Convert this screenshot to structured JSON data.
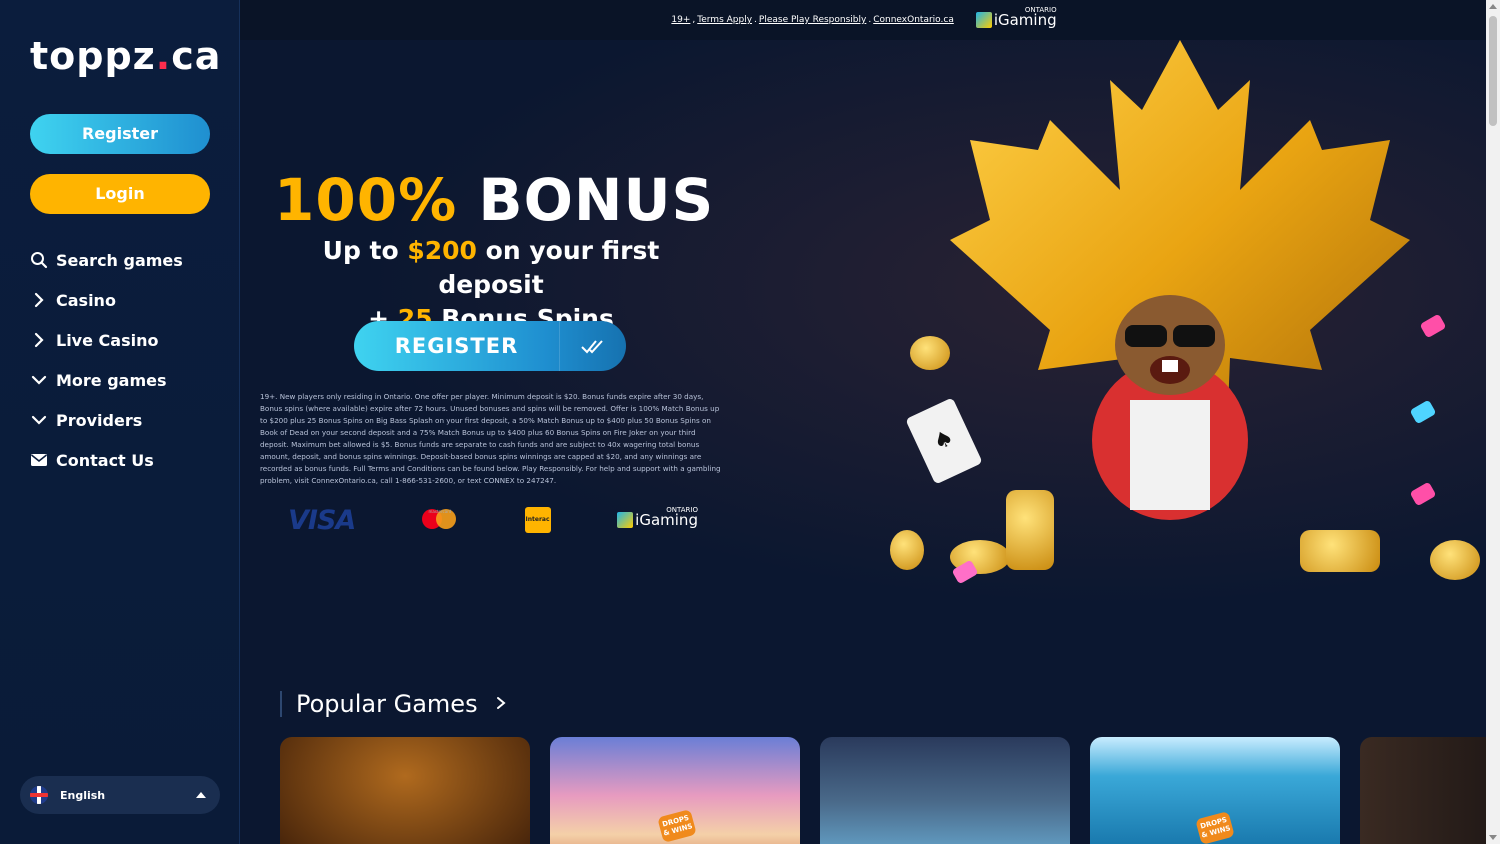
{
  "brand": {
    "logo_main": "toppz",
    "logo_dot": ".",
    "logo_tld": "ca"
  },
  "sidebar": {
    "register_label": "Register",
    "login_label": "Login",
    "items": [
      {
        "label": "Search games",
        "icon": "search-icon"
      },
      {
        "label": "Casino",
        "icon": "chevron-right-icon"
      },
      {
        "label": "Live Casino",
        "icon": "chevron-right-icon"
      },
      {
        "label": "More games",
        "icon": "chevron-down-icon"
      },
      {
        "label": "Providers",
        "icon": "chevron-down-icon"
      },
      {
        "label": "Contact Us",
        "icon": "mail-icon"
      }
    ],
    "language": "English"
  },
  "topbar": {
    "age": "19+",
    "terms": "Terms Apply",
    "play_responsibly": "Please Play Responsibly",
    "connex": "ConnexOntario.ca",
    "igaming": "iGaming",
    "ontario": "ONTARIO"
  },
  "hero": {
    "bonus_pct": "100%",
    "bonus_word": "BONUS",
    "line1_a": "Up to ",
    "line1_amount": "$200",
    "line1_b": " on your first deposit",
    "line2_a": "+ ",
    "line2_spins": "25",
    "line2_b": " Bonus Spins",
    "register_label": "REGISTER",
    "terms_text": "19+. New players only residing in Ontario. One offer per player. Minimum deposit is $20. Bonus funds expire after 30 days, Bonus spins (where available) expire after 72 hours. Unused bonuses and spins will be removed. Offer is 100% Match Bonus up to $200 plus 25 Bonus Spins on Big Bass Splash on your first deposit, a 50% Match Bonus up to $400 plus 50 Bonus Spins on Book of Dead on your second deposit and a 75% Match Bonus up to $400 plus 60 Bonus Spins on Fire Joker on your third deposit. Maximum bet allowed is $5. Bonus funds are separate to cash funds and are subject to 40x wagering total bonus amount, deposit, and bonus spins winnings. Deposit-based bonus spins winnings are capped at $20, and any winnings are recorded as bonus funds. Full Terms and Conditions can be found below. Play Responsibly. For help and support with a gambling problem, visit ConnexOntario.ca, call 1-866-531-2600, or text CONNEX to 247247.",
    "payments": {
      "visa": "VISA",
      "mastercard": "mastercard",
      "interac": "Interac",
      "igaming": "iGaming",
      "ontario": "ONTARIO"
    }
  },
  "popular": {
    "title": "Popular Games",
    "drops_wins": "DROPS & WINS"
  },
  "colors": {
    "accent_gold": "#ffb400",
    "accent_cyan": "#3fd3f0",
    "logo_dot": "#ff2d4d"
  }
}
